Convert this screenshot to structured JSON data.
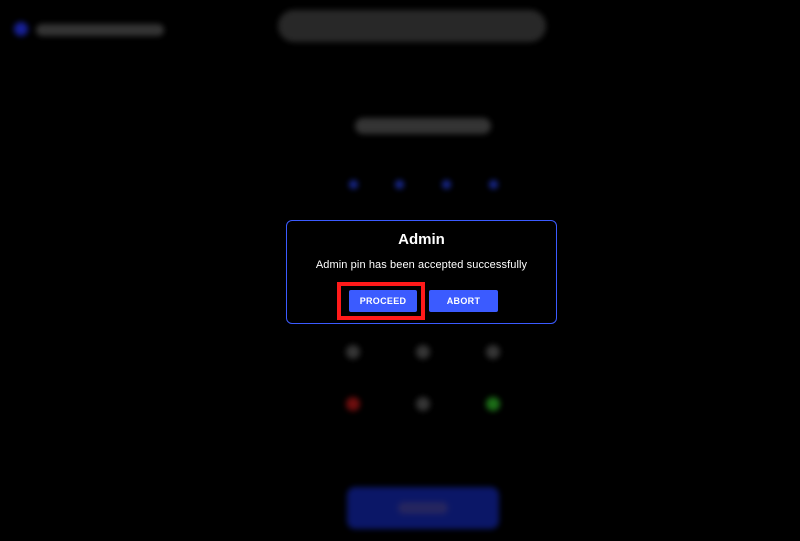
{
  "dialog": {
    "title": "Admin",
    "message": "Admin pin has been accepted successfully",
    "proceed_label": "PROCEED",
    "abort_label": "ABORT"
  },
  "colors": {
    "background": "#000000",
    "accent": "#3b5bff",
    "highlight": "#ff1a1a",
    "text": "#ffffff"
  },
  "background": {
    "pin_dot_count": 4
  },
  "icons": [
    "pin-dot",
    "keypad-key"
  ]
}
